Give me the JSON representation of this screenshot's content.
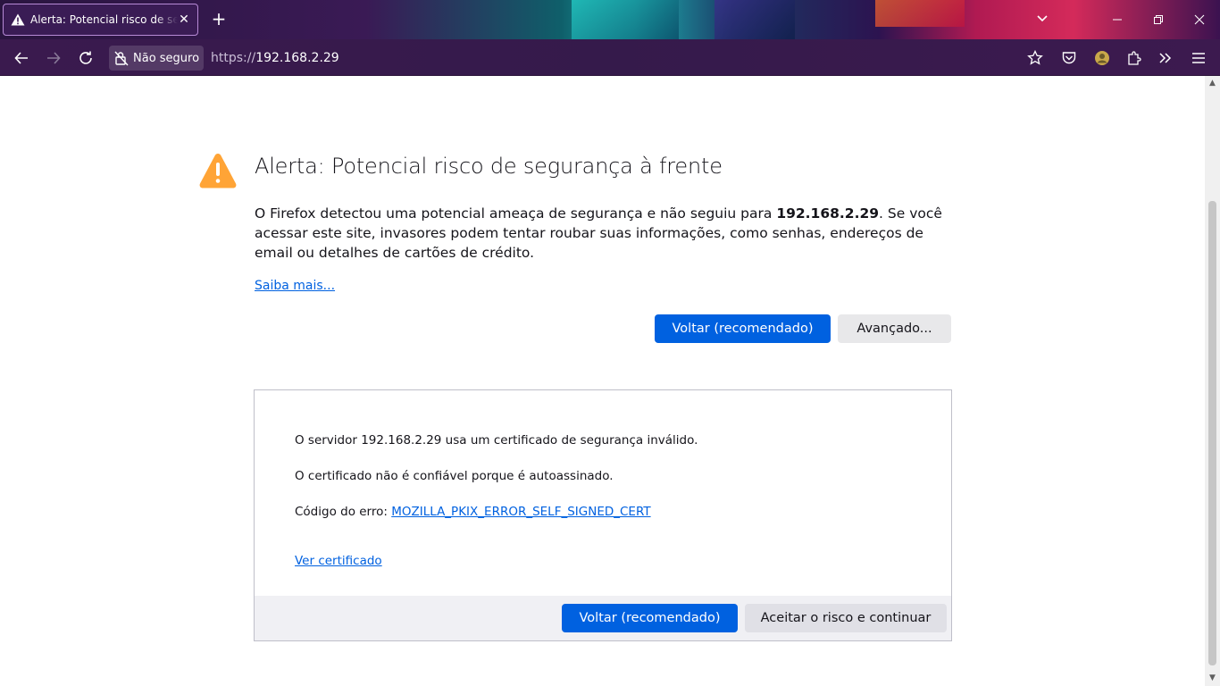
{
  "browser": {
    "tab": {
      "title": "Alerta: Potencial risco de segurança à frente",
      "close_glyph": "✕",
      "icon": "warning-icon"
    },
    "new_tab_glyph": "+",
    "url_bar": {
      "security_label": "Não seguro",
      "url_scheme": "https://",
      "url_host": "192.168.2.29"
    },
    "toolbar_icons": [
      "back-icon",
      "forward-icon",
      "reload-icon",
      "bookmark-star-icon",
      "pocket-icon",
      "profile-avatar-icon",
      "extensions-icon",
      "overflow-chevrons-icon",
      "menu-hamburger-icon"
    ],
    "window_controls": [
      "minimize",
      "restore",
      "close"
    ]
  },
  "page": {
    "title": "Alerta: Potencial risco de segurança à frente",
    "description_before": "O Firefox detectou uma potencial ameaça de segurança e não seguiu para ",
    "description_host": "192.168.2.29",
    "description_after": ". Se você acessar este site, invasores podem tentar roubar suas informações, como senhas, endereços de email ou detalhes de cartões de crédito.",
    "learn_more": "Saiba mais...",
    "go_back_label": "Voltar (recomendado)",
    "advanced_label": "Avançado..."
  },
  "advanced_panel": {
    "line1": "O servidor 192.168.2.29 usa um certificado de segurança inválido.",
    "line2": "O certificado não é confiável porque é autoassinado.",
    "error_code_label": "Código do erro: ",
    "error_code": "MOZILLA_PKIX_ERROR_SELF_SIGNED_CERT",
    "view_certificate": "Ver certificado",
    "go_back_label": "Voltar (recomendado)",
    "accept_label": "Aceitar o risco e continuar"
  },
  "colors": {
    "primary_button": "#0061e0",
    "warning": "#ffa436",
    "link": "#0061e0"
  }
}
